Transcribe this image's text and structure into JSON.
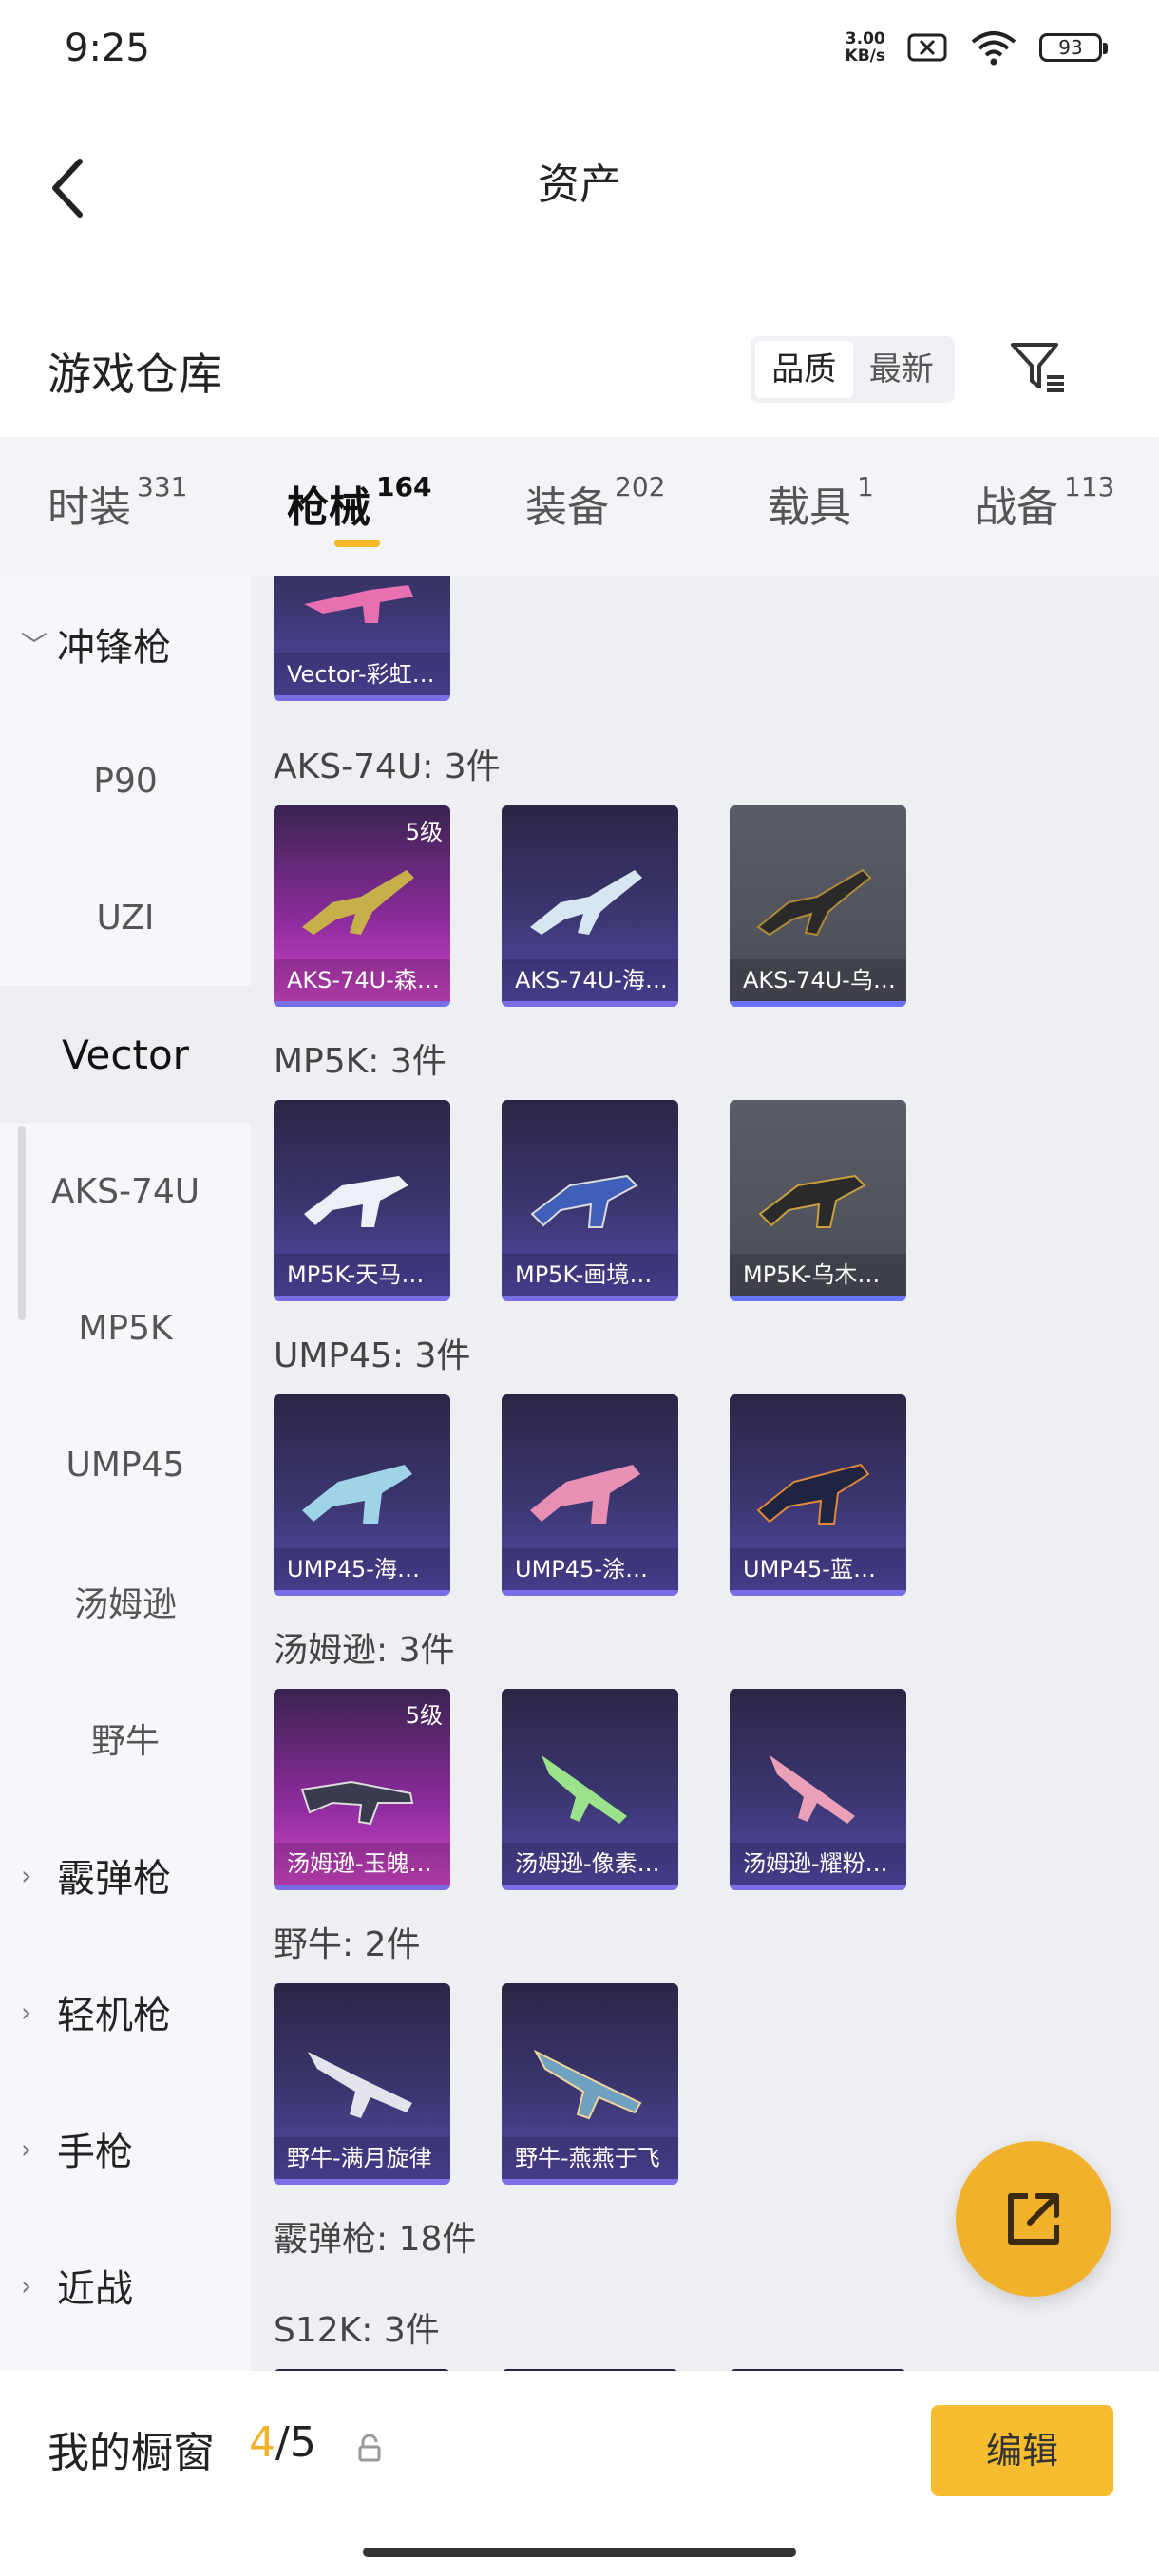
{
  "status": {
    "time": "9:25",
    "net_speed_value": "3.00",
    "net_speed_unit": "KB/s",
    "battery": "93"
  },
  "header": {
    "title": "资产"
  },
  "warehouse": {
    "title": "游戏仓库",
    "sort_options": [
      "品质",
      "最新"
    ],
    "active_sort": "品质"
  },
  "tabs": [
    {
      "label": "时装",
      "count": "331"
    },
    {
      "label": "枪械",
      "count": "164"
    },
    {
      "label": "装备",
      "count": "202"
    },
    {
      "label": "载具",
      "count": "1"
    },
    {
      "label": "战备",
      "count": "113"
    }
  ],
  "categories": {
    "smg_group": "冲锋枪",
    "items": [
      "P90",
      "UZI",
      "Vector",
      "AKS-74U",
      "MP5K",
      "UMP45",
      "汤姆逊",
      "野牛"
    ],
    "selected": "Vector",
    "groups": [
      "霰弹枪",
      "轻机枪",
      "手枪",
      "近战"
    ]
  },
  "content": {
    "top_card": {
      "name": "Vector-彩虹…"
    },
    "sections": [
      {
        "title": "AKS-74U: 3件",
        "items": [
          {
            "name": "AKS-74U-森…",
            "level": "5级"
          },
          {
            "name": "AKS-74U-海…",
            "level": ""
          },
          {
            "name": "AKS-74U-乌…",
            "level": ""
          }
        ]
      },
      {
        "title": "MP5K: 3件",
        "items": [
          {
            "name": "MP5K-天马…",
            "level": ""
          },
          {
            "name": "MP5K-画境…",
            "level": ""
          },
          {
            "name": "MP5K-乌木…",
            "level": ""
          }
        ]
      },
      {
        "title": "UMP45: 3件",
        "items": [
          {
            "name": "UMP45-海…",
            "level": ""
          },
          {
            "name": "UMP45-涂…",
            "level": ""
          },
          {
            "name": "UMP45-蓝…",
            "level": ""
          }
        ]
      },
      {
        "title": "汤姆逊: 3件",
        "items": [
          {
            "name": "汤姆逊-玉魄…",
            "level": "5级"
          },
          {
            "name": "汤姆逊-像素…",
            "level": ""
          },
          {
            "name": "汤姆逊-耀粉…",
            "level": ""
          }
        ]
      },
      {
        "title": "野牛: 2件",
        "items": [
          {
            "name": "野牛-满月旋律",
            "level": ""
          },
          {
            "name": "野牛-燕燕于飞",
            "level": ""
          }
        ]
      }
    ],
    "shotgun_title": "霰弹枪: 18件",
    "s12k_title": "S12K: 3件"
  },
  "bottom": {
    "showcase_label": "我的橱窗",
    "showcase_current": "4",
    "showcase_total": "/5",
    "edit_label": "编辑"
  },
  "colors": {
    "accent": "#f2b12a",
    "tab_underline": "#f5b92a"
  }
}
